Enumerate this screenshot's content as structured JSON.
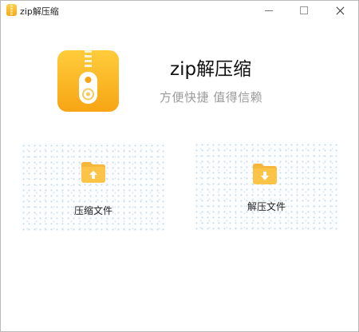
{
  "window": {
    "title": "zip解压缩",
    "buttons": {
      "minimize": "minimize",
      "maximize": "maximize",
      "close": "close"
    }
  },
  "header": {
    "app_name": "zip解压缩",
    "slogan": "方便快捷 值得信赖",
    "logo_icon": "zipper-file-icon"
  },
  "actions": {
    "compress": {
      "label": "压缩文件",
      "icon": "folder-upload-icon"
    },
    "extract": {
      "label": "解压文件",
      "icon": "folder-download-icon"
    }
  },
  "colors": {
    "accent_yellow": "#f7a514",
    "accent_light": "#ffcc3b",
    "slogan": "#9b9b9b",
    "card_pattern": "#c9dcea"
  }
}
